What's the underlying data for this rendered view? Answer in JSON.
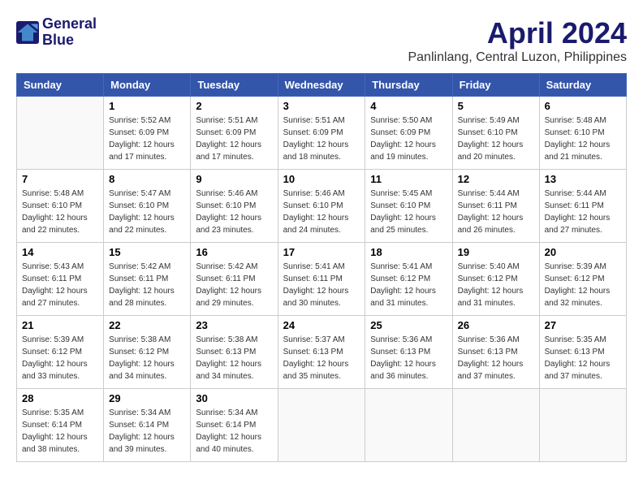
{
  "logo": {
    "line1": "General",
    "line2": "Blue"
  },
  "title": {
    "month_year": "April 2024",
    "location": "Panlinlang, Central Luzon, Philippines"
  },
  "header": {
    "days": [
      "Sunday",
      "Monday",
      "Tuesday",
      "Wednesday",
      "Thursday",
      "Friday",
      "Saturday"
    ]
  },
  "weeks": [
    [
      {
        "day": "",
        "info": ""
      },
      {
        "day": "1",
        "info": "Sunrise: 5:52 AM\nSunset: 6:09 PM\nDaylight: 12 hours\nand 17 minutes."
      },
      {
        "day": "2",
        "info": "Sunrise: 5:51 AM\nSunset: 6:09 PM\nDaylight: 12 hours\nand 17 minutes."
      },
      {
        "day": "3",
        "info": "Sunrise: 5:51 AM\nSunset: 6:09 PM\nDaylight: 12 hours\nand 18 minutes."
      },
      {
        "day": "4",
        "info": "Sunrise: 5:50 AM\nSunset: 6:09 PM\nDaylight: 12 hours\nand 19 minutes."
      },
      {
        "day": "5",
        "info": "Sunrise: 5:49 AM\nSunset: 6:10 PM\nDaylight: 12 hours\nand 20 minutes."
      },
      {
        "day": "6",
        "info": "Sunrise: 5:48 AM\nSunset: 6:10 PM\nDaylight: 12 hours\nand 21 minutes."
      }
    ],
    [
      {
        "day": "7",
        "info": "Sunrise: 5:48 AM\nSunset: 6:10 PM\nDaylight: 12 hours\nand 22 minutes."
      },
      {
        "day": "8",
        "info": "Sunrise: 5:47 AM\nSunset: 6:10 PM\nDaylight: 12 hours\nand 22 minutes."
      },
      {
        "day": "9",
        "info": "Sunrise: 5:46 AM\nSunset: 6:10 PM\nDaylight: 12 hours\nand 23 minutes."
      },
      {
        "day": "10",
        "info": "Sunrise: 5:46 AM\nSunset: 6:10 PM\nDaylight: 12 hours\nand 24 minutes."
      },
      {
        "day": "11",
        "info": "Sunrise: 5:45 AM\nSunset: 6:10 PM\nDaylight: 12 hours\nand 25 minutes."
      },
      {
        "day": "12",
        "info": "Sunrise: 5:44 AM\nSunset: 6:11 PM\nDaylight: 12 hours\nand 26 minutes."
      },
      {
        "day": "13",
        "info": "Sunrise: 5:44 AM\nSunset: 6:11 PM\nDaylight: 12 hours\nand 27 minutes."
      }
    ],
    [
      {
        "day": "14",
        "info": "Sunrise: 5:43 AM\nSunset: 6:11 PM\nDaylight: 12 hours\nand 27 minutes."
      },
      {
        "day": "15",
        "info": "Sunrise: 5:42 AM\nSunset: 6:11 PM\nDaylight: 12 hours\nand 28 minutes."
      },
      {
        "day": "16",
        "info": "Sunrise: 5:42 AM\nSunset: 6:11 PM\nDaylight: 12 hours\nand 29 minutes."
      },
      {
        "day": "17",
        "info": "Sunrise: 5:41 AM\nSunset: 6:11 PM\nDaylight: 12 hours\nand 30 minutes."
      },
      {
        "day": "18",
        "info": "Sunrise: 5:41 AM\nSunset: 6:12 PM\nDaylight: 12 hours\nand 31 minutes."
      },
      {
        "day": "19",
        "info": "Sunrise: 5:40 AM\nSunset: 6:12 PM\nDaylight: 12 hours\nand 31 minutes."
      },
      {
        "day": "20",
        "info": "Sunrise: 5:39 AM\nSunset: 6:12 PM\nDaylight: 12 hours\nand 32 minutes."
      }
    ],
    [
      {
        "day": "21",
        "info": "Sunrise: 5:39 AM\nSunset: 6:12 PM\nDaylight: 12 hours\nand 33 minutes."
      },
      {
        "day": "22",
        "info": "Sunrise: 5:38 AM\nSunset: 6:12 PM\nDaylight: 12 hours\nand 34 minutes."
      },
      {
        "day": "23",
        "info": "Sunrise: 5:38 AM\nSunset: 6:13 PM\nDaylight: 12 hours\nand 34 minutes."
      },
      {
        "day": "24",
        "info": "Sunrise: 5:37 AM\nSunset: 6:13 PM\nDaylight: 12 hours\nand 35 minutes."
      },
      {
        "day": "25",
        "info": "Sunrise: 5:36 AM\nSunset: 6:13 PM\nDaylight: 12 hours\nand 36 minutes."
      },
      {
        "day": "26",
        "info": "Sunrise: 5:36 AM\nSunset: 6:13 PM\nDaylight: 12 hours\nand 37 minutes."
      },
      {
        "day": "27",
        "info": "Sunrise: 5:35 AM\nSunset: 6:13 PM\nDaylight: 12 hours\nand 37 minutes."
      }
    ],
    [
      {
        "day": "28",
        "info": "Sunrise: 5:35 AM\nSunset: 6:14 PM\nDaylight: 12 hours\nand 38 minutes."
      },
      {
        "day": "29",
        "info": "Sunrise: 5:34 AM\nSunset: 6:14 PM\nDaylight: 12 hours\nand 39 minutes."
      },
      {
        "day": "30",
        "info": "Sunrise: 5:34 AM\nSunset: 6:14 PM\nDaylight: 12 hours\nand 40 minutes."
      },
      {
        "day": "",
        "info": ""
      },
      {
        "day": "",
        "info": ""
      },
      {
        "day": "",
        "info": ""
      },
      {
        "day": "",
        "info": ""
      }
    ]
  ]
}
